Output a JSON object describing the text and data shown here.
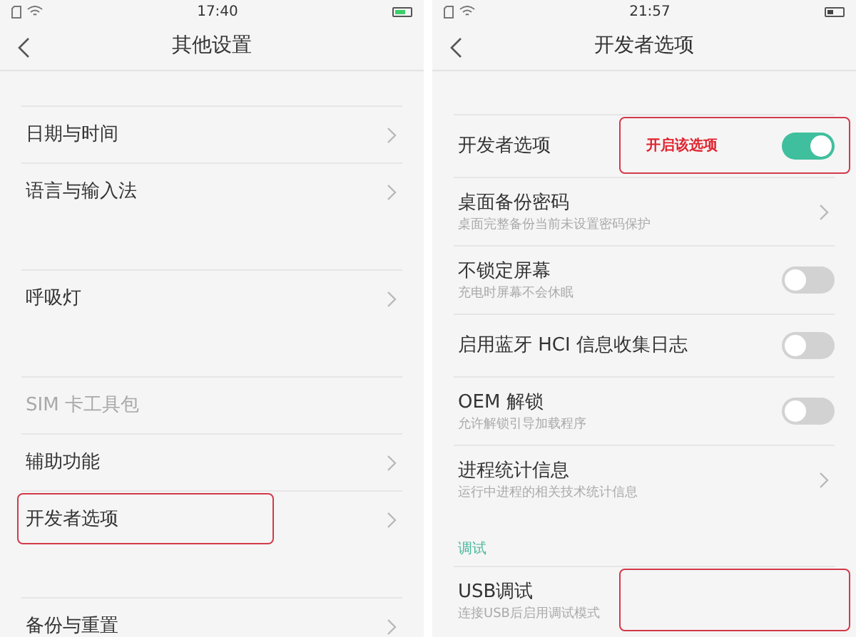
{
  "screens": [
    {
      "status_bar": {
        "time": "17:40",
        "charging": true
      },
      "title": "其他设置",
      "groups": [
        {
          "items": [
            {
              "label": "日期与时间",
              "kind": "link",
              "disabled": false
            },
            {
              "label": "语言与输入法",
              "kind": "link",
              "disabled": false
            }
          ]
        },
        {
          "items": [
            {
              "label": "呼吸灯",
              "kind": "link",
              "disabled": false
            }
          ]
        },
        {
          "items": [
            {
              "label": "SIM 卡工具包",
              "kind": "plain",
              "disabled": true
            },
            {
              "label": "辅助功能",
              "kind": "link",
              "disabled": false
            },
            {
              "label": "开发者选项",
              "kind": "link",
              "disabled": false,
              "outlined": true
            }
          ]
        },
        {
          "items": [
            {
              "label": "备份与重置",
              "kind": "link",
              "disabled": false
            }
          ]
        }
      ]
    },
    {
      "status_bar": {
        "time": "21:57",
        "charging": false
      },
      "title": "开发者选项",
      "groups": [
        {
          "items": [
            {
              "label": "开发者选项",
              "kind": "switch",
              "on": true,
              "boxed": true,
              "callout_text": "开启该选项"
            },
            {
              "label": "桌面备份密码",
              "subtitle": "桌面完整备份当前未设置密码保护",
              "kind": "link"
            },
            {
              "label": "不锁定屏幕",
              "subtitle": "充电时屏幕不会休眠",
              "kind": "switch",
              "on": false
            },
            {
              "label": "启用蓝牙 HCI 信息收集日志",
              "kind": "switch",
              "on": false
            },
            {
              "label": "OEM 解锁",
              "subtitle": "允许解锁引导加载程序",
              "kind": "switch",
              "on": false
            },
            {
              "label": "进程统计信息",
              "subtitle": "运行中进程的相关技术统计信息",
              "kind": "link"
            }
          ]
        },
        {
          "header": "调试",
          "items": [
            {
              "label": "USB调试",
              "subtitle": "连接USB后启用调试模式",
              "kind": "plain",
              "boxed": true
            }
          ]
        }
      ]
    }
  ]
}
